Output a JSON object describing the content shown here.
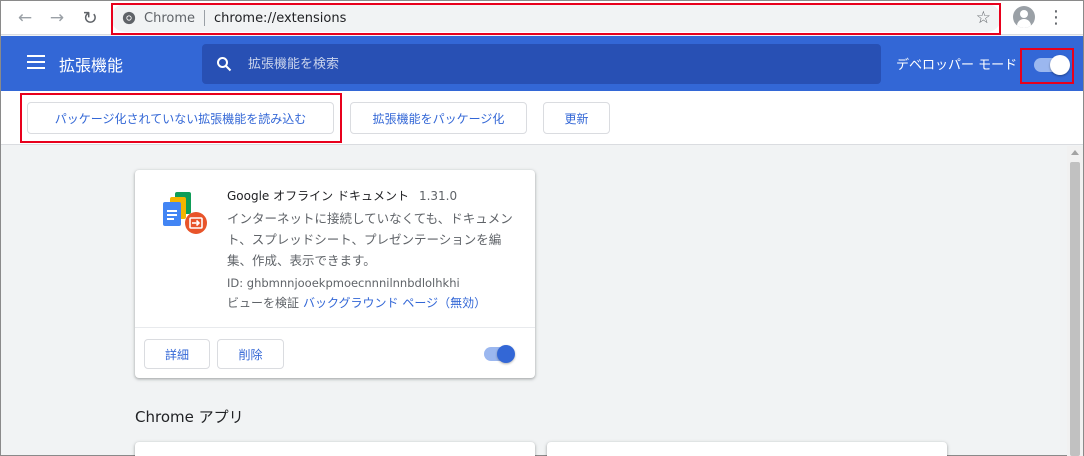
{
  "browser": {
    "chip_label": "Chrome",
    "url": "chrome://extensions"
  },
  "header": {
    "title": "拡張機能",
    "search_placeholder": "拡張機能を検索",
    "dev_mode_label": "デベロッパー モード",
    "dev_mode_on": true
  },
  "toolbar": {
    "load_unpacked": "パッケージ化されていない拡張機能を読み込む",
    "pack": "拡張機能をパッケージ化",
    "update": "更新"
  },
  "extension": {
    "name": "Google オフライン ドキュメント",
    "version": "1.31.0",
    "description": "インターネットに接続していなくても、ドキュメント、スプレッドシート、プレゼンテーションを編集、作成、表示できます。",
    "id_line": "ID: ghbmnnjooekpmoecnnnilnnbdlolhkhi",
    "inspect_label": "ビューを検証",
    "inspect_link": "バックグラウンド ページ（無効）",
    "details_label": "詳細",
    "remove_label": "削除",
    "enabled": true
  },
  "apps_section": {
    "title": "Chrome アプリ"
  },
  "colors": {
    "header_blue": "#3367d6",
    "highlight_red": "#e8001c"
  },
  "icons": [
    "back-arrow-icon",
    "forward-arrow-icon",
    "reload-icon",
    "chrome-site-icon",
    "star-icon",
    "profile-icon",
    "more-vert-icon",
    "hamburger-icon",
    "search-icon",
    "docs-offline-icon"
  ]
}
